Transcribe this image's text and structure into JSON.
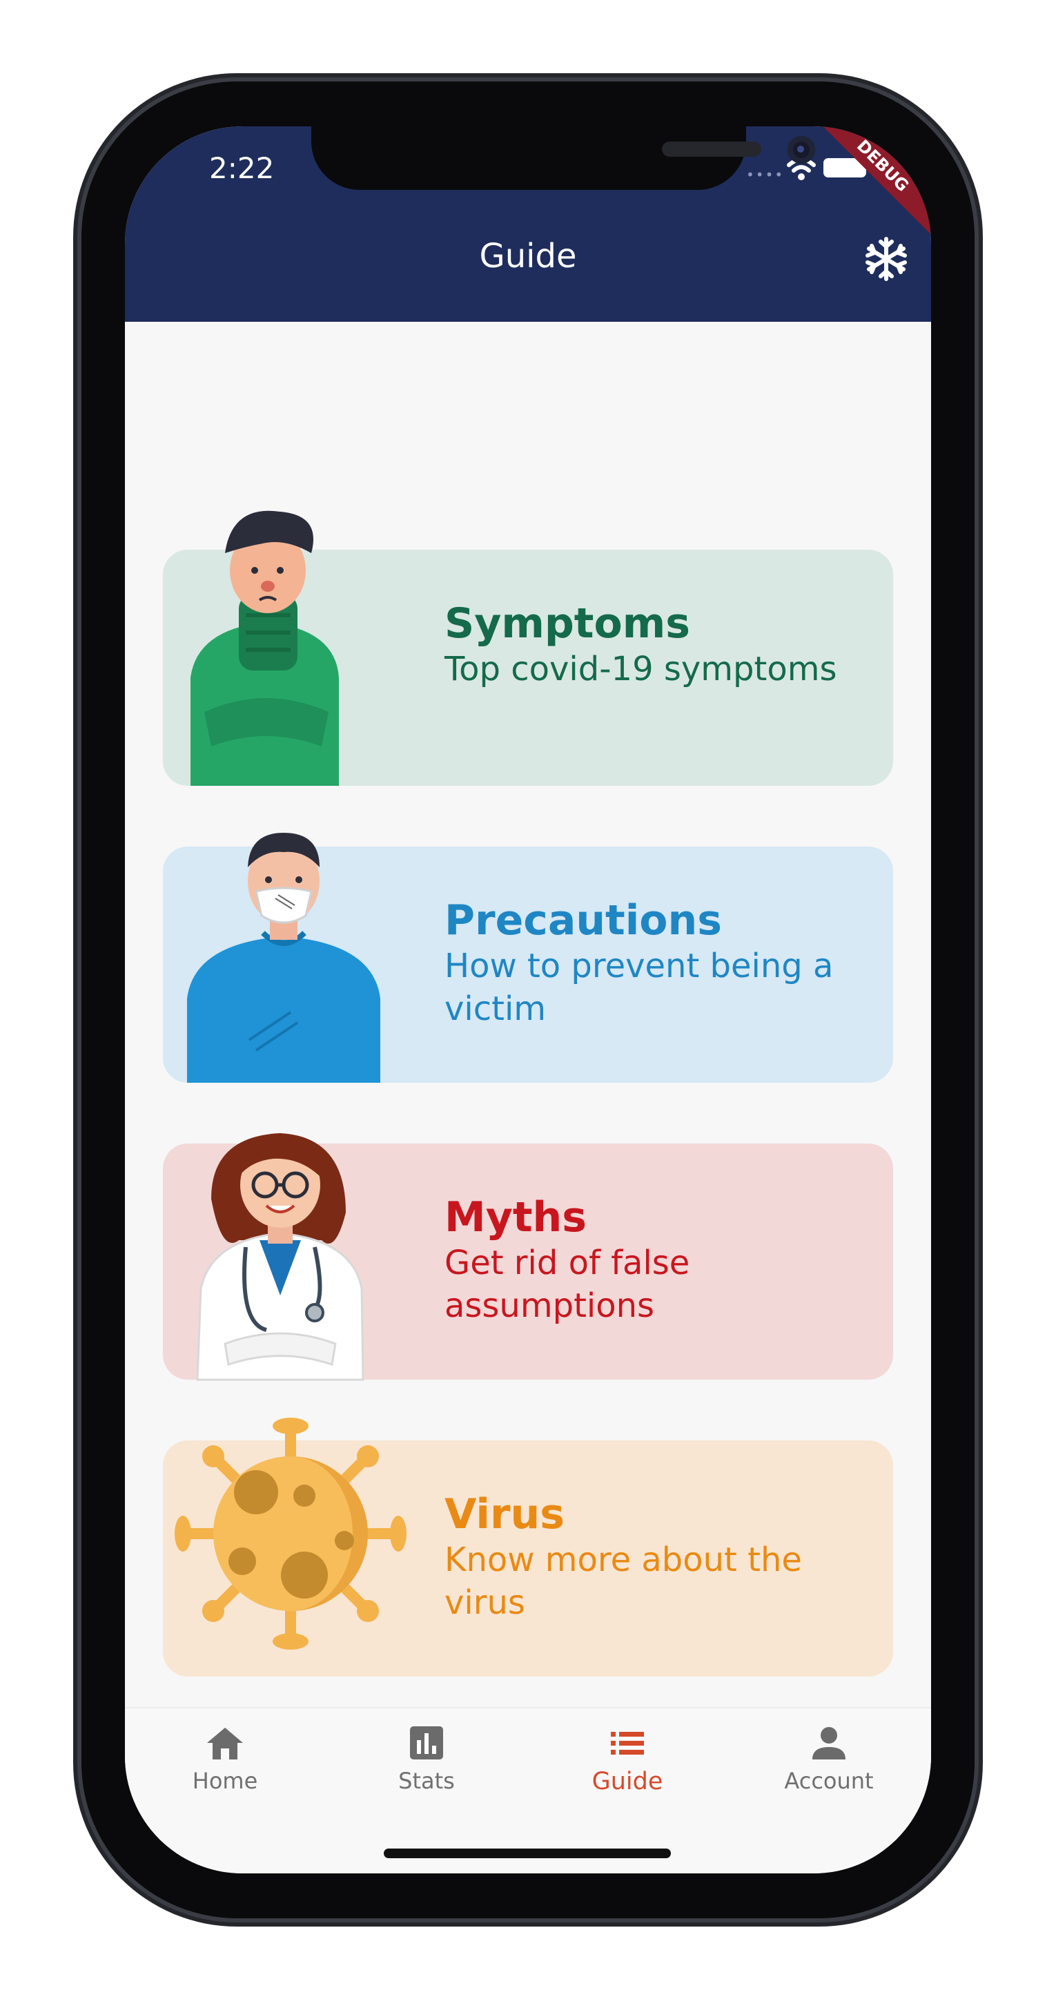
{
  "status_bar": {
    "time": "2:22",
    "debug_label": "DEBUG"
  },
  "app_bar": {
    "title": "Guide",
    "action_icon": "snowflake-icon"
  },
  "cards": [
    {
      "title": "Symptoms",
      "subtitle": "Top covid-19 symptoms",
      "bg": "#d9e8e3",
      "color": "#146a4b",
      "illustration": "sick-man"
    },
    {
      "title": "Precautions",
      "subtitle": "How to prevent being a victim",
      "bg": "#d6e9f4",
      "color": "#1f86c4",
      "illustration": "masked-man"
    },
    {
      "title": "Myths",
      "subtitle": "Get rid of false assumptions",
      "bg": "#f3d8d8",
      "color": "#c8161e",
      "illustration": "doctor"
    },
    {
      "title": "Virus",
      "subtitle": "Know more about the virus",
      "bg": "#f8e6d3",
      "color": "#e98a14",
      "illustration": "virus"
    }
  ],
  "bottom_nav": {
    "items": [
      {
        "label": "Home",
        "icon": "home-icon",
        "active": false
      },
      {
        "label": "Stats",
        "icon": "stats-icon",
        "active": false
      },
      {
        "label": "Guide",
        "icon": "list-icon",
        "active": true
      },
      {
        "label": "Account",
        "icon": "person-icon",
        "active": false
      }
    ],
    "active_color": "#d44a2a"
  }
}
